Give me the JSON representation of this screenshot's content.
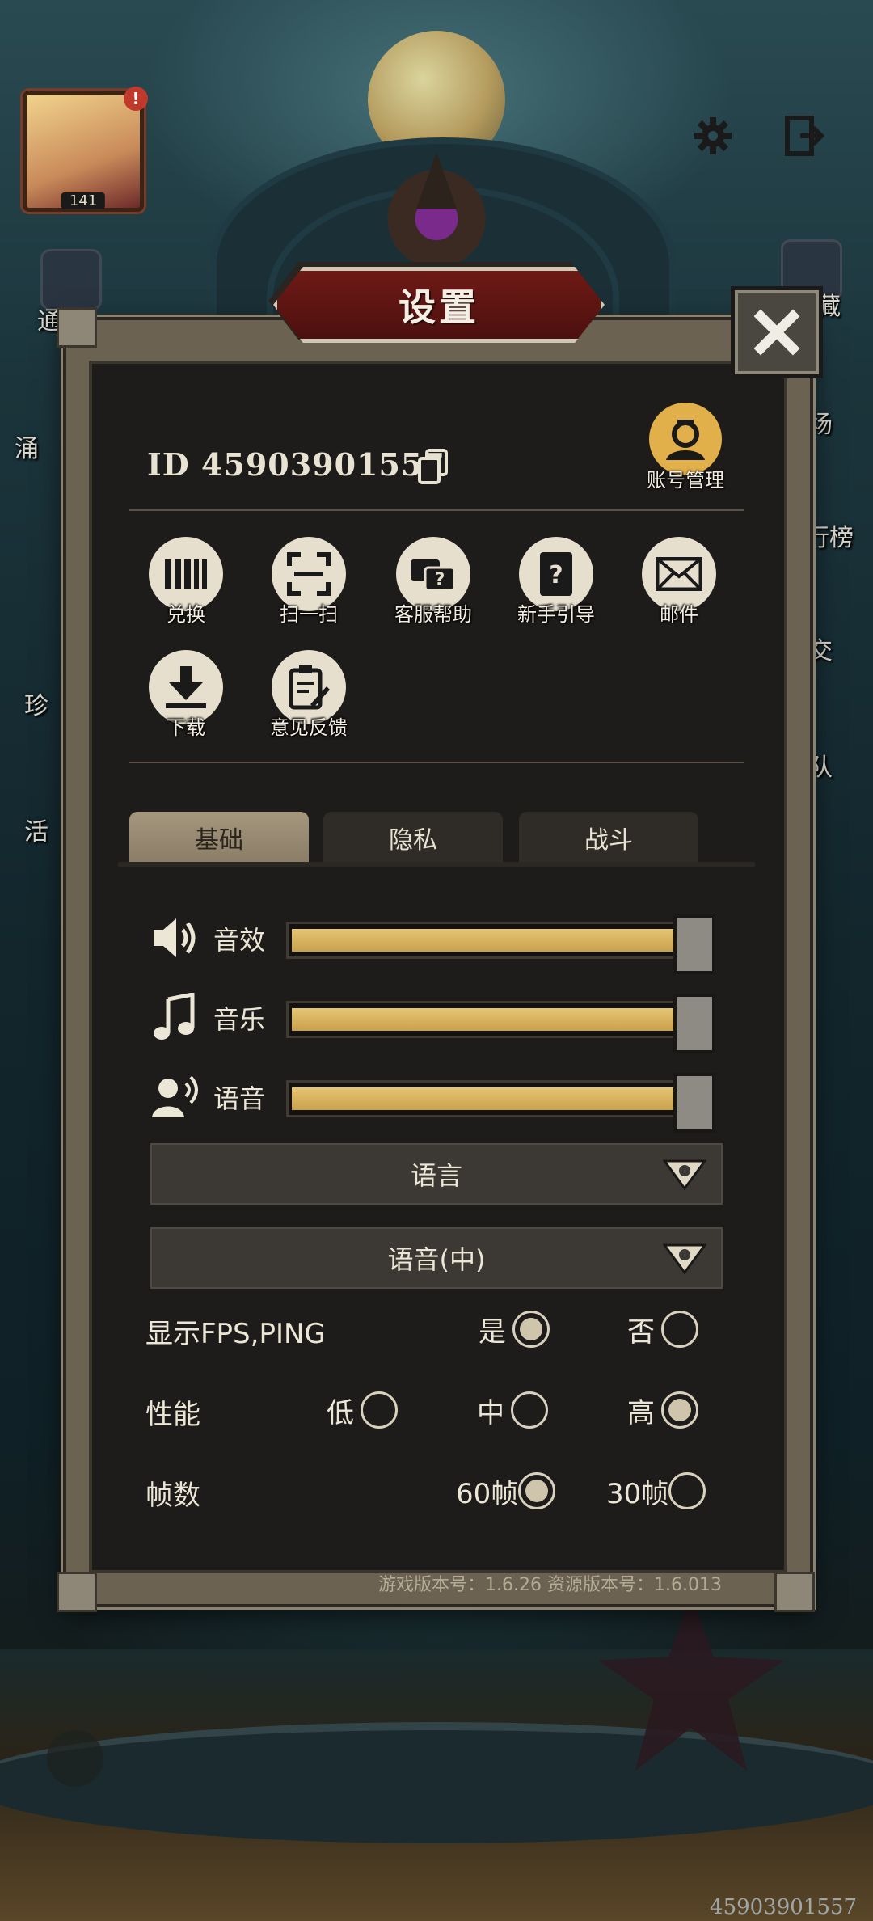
{
  "dialog": {
    "title": "设置",
    "player_id": "ID 45903901557",
    "account_label": "账号管理"
  },
  "functions": [
    {
      "label": "兑换",
      "icon": "barcode-icon"
    },
    {
      "label": "扫一扫",
      "icon": "scan-icon"
    },
    {
      "label": "客服帮助",
      "icon": "help-chat-icon"
    },
    {
      "label": "新手引导",
      "icon": "guide-book-icon"
    },
    {
      "label": "邮件",
      "icon": "mail-icon"
    },
    {
      "label": "下载",
      "icon": "download-icon"
    },
    {
      "label": "意见反馈",
      "icon": "feedback-icon"
    }
  ],
  "tabs": [
    {
      "label": "基础",
      "active": true
    },
    {
      "label": "隐私",
      "active": false
    },
    {
      "label": "战斗",
      "active": false
    }
  ],
  "sliders": [
    {
      "label": "音效",
      "icon": "speaker-icon",
      "value": 1.0
    },
    {
      "label": "音乐",
      "icon": "music-note-icon",
      "value": 1.0
    },
    {
      "label": "语音",
      "icon": "voice-icon",
      "value": 1.0
    }
  ],
  "dropdowns": {
    "language": "语言",
    "voice_language": "语音(中)"
  },
  "options": {
    "fps_ping": {
      "title": "显示FPS,PING",
      "yes": "是",
      "no": "否",
      "selected": "yes"
    },
    "performance": {
      "title": "性能",
      "low": "低",
      "mid": "中",
      "high": "高",
      "selected": "high"
    },
    "frame_rate": {
      "title": "帧数",
      "fps60": "60帧",
      "fps30": "30帧",
      "selected": "fps60"
    }
  },
  "version_text": "游戏版本号：1.6.26    资源版本号：1.6.013",
  "footer_id": "45903901557",
  "avatar_level": "141",
  "avatar_badge": "!",
  "background_labels": [
    "通",
    "涌",
    "珍",
    "活",
    "藏",
    "场",
    "行榜",
    "交",
    "队"
  ],
  "colors": {
    "accent": "#e2b04a",
    "title_plate": "#6e1a16",
    "panel_bg": "#1e1c1a",
    "slider_fill": "#d9b35e"
  }
}
